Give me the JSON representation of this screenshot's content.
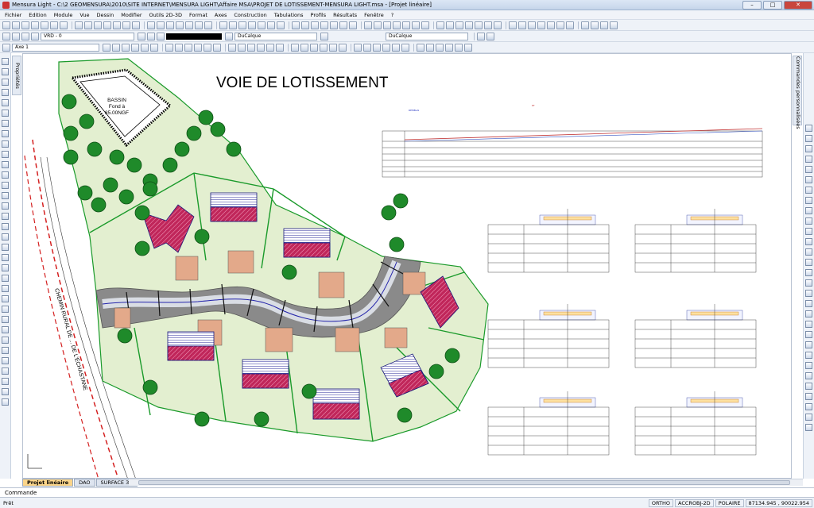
{
  "window": {
    "title": "Mensura Light - C:\\2 GEOMENSURA\\2010\\SITE INTERNET\\MENSURA LIGHT\\Affaire MSA\\PROJET DE LOTISSEMENT-MENSURA LIGHT.msa - [Projet linéaire]",
    "minimize": "–",
    "maximize": "□",
    "close": "✕"
  },
  "menu": [
    "Fichier",
    "Edition",
    "Module",
    "Vue",
    "Dessin",
    "Modifier",
    "Outils 2D-3D",
    "Format",
    "Axes",
    "Construction",
    "Tabulations",
    "Profils",
    "Résultats",
    "Fenêtre",
    "?"
  ],
  "toolbar": {
    "layer": "VRD - 0",
    "linetype": "DuCalque",
    "lineweight": "DuCalque",
    "axis": "Axe 1"
  },
  "side_tabs": {
    "left": "Propriétés",
    "right": "Commandes personnalisées"
  },
  "drawing": {
    "title": "VOIE DE LOTISSEMENT",
    "basin_label": [
      "BASSIN",
      "Fond à",
      "85.00NGF"
    ],
    "road_name": "CHEMIN RURAL DE ... DE L'ÉCHASTANE"
  },
  "tabs": [
    "Projet linéaire",
    "DAO",
    "SURFACE 3D"
  ],
  "command": "Commande",
  "status": {
    "ready": "Prêt",
    "ortho": "ORTHO",
    "accrobj": "ACCROBJ-2D",
    "polaire": "POLAIRE",
    "coords": "87134.945 , 90022.954"
  },
  "colors": {
    "lot_fill": "#e3efd0",
    "lot_border": "#1a9a2a",
    "house_fill": "#c0265a",
    "house_roof": "#2a2a9a",
    "road_fill": "#777777",
    "parking_fill": "#e3a98a",
    "dashed_boundary": "#d42020"
  }
}
